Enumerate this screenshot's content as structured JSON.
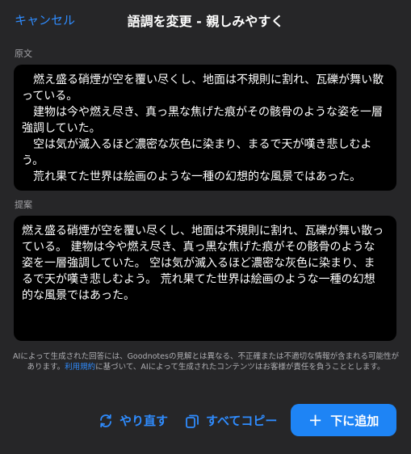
{
  "header": {
    "cancel_label": "キャンセル",
    "title": "語調を変更 - 親しみやすく"
  },
  "original": {
    "label": "原文",
    "paragraphs": [
      "燃え盛る硝煙が空を覆い尽くし、地面は不規則に割れ、瓦礫が舞い散っている。",
      "建物は今や燃え尽き、真っ黒な焦げた痕がその骸骨のような姿を一層強調していた。",
      "空は気が滅入るほど濃密な灰色に染まり、まるで天が嘆き悲しむよう。",
      "荒れ果てた世界は絵画のような一種の幻想的な風景ではあった。"
    ]
  },
  "suggestion": {
    "label": "提案",
    "text": "燃え盛る硝煙が空を覆い尽くし、地面は不規則に割れ、瓦礫が舞い散っている。 建物は今や燃え尽き、真っ黒な焦げた痕がその骸骨のような姿を一層強調していた。 空は気が滅入るほど濃密な灰色に染まり、まるで天が嘆き悲しむよう。 荒れ果てた世界は絵画のような一種の幻想的な風景ではあった。"
  },
  "disclaimer": {
    "before": "AIによって生成された回答には、Goodnotesの見解とは異なる、不正確または不適切な情報が含まれる可能性があります。",
    "link": "利用規約",
    "after": "に基づいて、AIによって生成されたコンテンツはお客様が責任を負うこととします。"
  },
  "actions": {
    "retry_label": "やり直す",
    "retry_icon": "retry-icon",
    "copy_label": "すべてコピー",
    "copy_icon": "copy-icon",
    "add_label": "下に追加",
    "add_icon": "plus-icon"
  },
  "colors": {
    "accent": "#2f8cff",
    "primary_button": "#1e84f5",
    "background": "#262628",
    "text_box": "#000000"
  }
}
